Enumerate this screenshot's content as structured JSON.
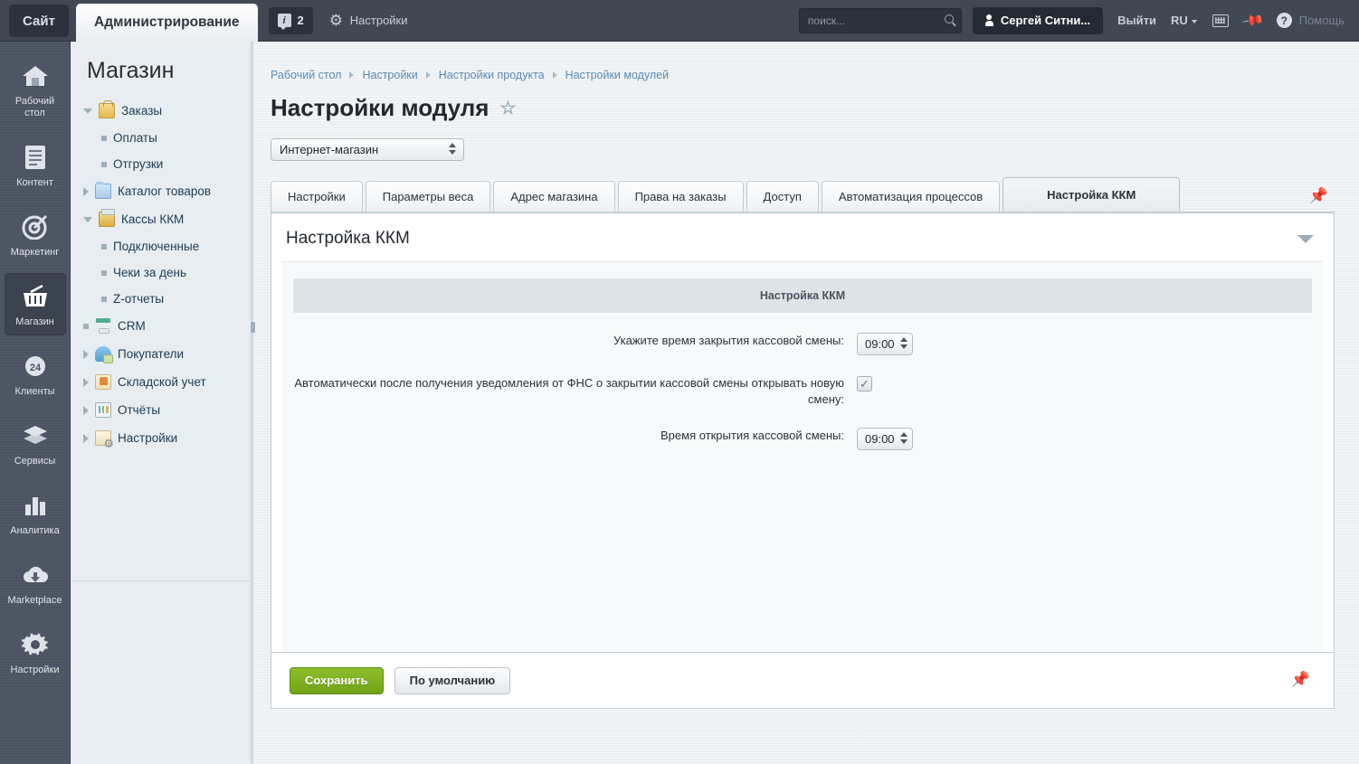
{
  "topbar": {
    "site_tab": "Сайт",
    "admin_tab": "Администрирование",
    "notif_count": "2",
    "notif_icon": "info-icon",
    "settings_label": "Настройки",
    "settings_icon": "gear-icon",
    "search_placeholder": "поиск...",
    "search_value": "",
    "search_icon": "search-icon",
    "user_name": "Сергей Ситни...",
    "user_icon": "person-icon",
    "logout_label": "Выйти",
    "lang_label": "RU",
    "keyboard_icon": "keyboard-icon",
    "pin_icon": "pin-icon",
    "help_label": "Помощь",
    "help_icon": "question-icon"
  },
  "rail": {
    "items": [
      {
        "label": "Рабочий стол",
        "icon": "home-icon",
        "active": false
      },
      {
        "label": "Контент",
        "icon": "document-icon",
        "active": false
      },
      {
        "label": "Маркетинг",
        "icon": "target-icon",
        "active": false
      },
      {
        "label": "Магазин",
        "icon": "basket-icon",
        "active": true
      },
      {
        "label": "Клиенты",
        "icon": "cloud24-icon",
        "active": false
      },
      {
        "label": "Сервисы",
        "icon": "layers-icon",
        "active": false
      },
      {
        "label": "Аналитика",
        "icon": "barchart-icon",
        "active": false
      },
      {
        "label": "Marketplace",
        "icon": "cloud-download-icon",
        "active": false
      },
      {
        "label": "Настройки",
        "icon": "gear-icon",
        "active": false
      }
    ]
  },
  "sidebar": {
    "title": "Магазин",
    "items": [
      {
        "label": "Заказы",
        "level": 0,
        "state": "open",
        "icon": "bag-icon"
      },
      {
        "label": "Оплаты",
        "level": 1,
        "state": "leaf",
        "icon": "bullet-icon"
      },
      {
        "label": "Отгрузки",
        "level": 1,
        "state": "leaf",
        "icon": "bullet-icon"
      },
      {
        "label": "Каталог товаров",
        "level": 0,
        "state": "closed",
        "icon": "folder-icon"
      },
      {
        "label": "Кассы ККМ",
        "level": 0,
        "state": "open",
        "icon": "cashregister-icon"
      },
      {
        "label": "Подключенные",
        "level": 1,
        "state": "leaf",
        "icon": "bullet-icon"
      },
      {
        "label": "Чеки за день",
        "level": 1,
        "state": "leaf",
        "icon": "bullet-icon"
      },
      {
        "label": "Z-отчеты",
        "level": 1,
        "state": "leaf",
        "icon": "bullet-icon"
      },
      {
        "label": "CRM",
        "level": 0,
        "state": "dot",
        "icon": "crm-icon"
      },
      {
        "label": "Покупатели",
        "level": 0,
        "state": "closed",
        "icon": "users-icon"
      },
      {
        "label": "Складской учет",
        "level": 0,
        "state": "closed",
        "icon": "warehouse-icon"
      },
      {
        "label": "Отчёты",
        "level": 0,
        "state": "closed",
        "icon": "report-icon"
      },
      {
        "label": "Настройки",
        "level": 0,
        "state": "closed",
        "icon": "settings-icon"
      }
    ]
  },
  "breadcrumbs": [
    "Рабочий стол",
    "Настройки",
    "Настройки продукта",
    "Настройки модулей"
  ],
  "page": {
    "title": "Настройки модуля",
    "favorite_icon": "star-icon",
    "module_select_value": "Интернет-магазин"
  },
  "tabs": [
    {
      "label": "Настройки",
      "active": false
    },
    {
      "label": "Параметры веса",
      "active": false
    },
    {
      "label": "Адрес магазина",
      "active": false
    },
    {
      "label": "Права на заказы",
      "active": false
    },
    {
      "label": "Доступ",
      "active": false
    },
    {
      "label": "Автоматизация процессов",
      "active": false
    },
    {
      "label": "Настройка ККМ",
      "active": true
    }
  ],
  "panel": {
    "title": "Настройка ККМ",
    "collapse_icon": "chevron-down-icon",
    "section_header": "Настройка ККМ",
    "fields": [
      {
        "label": "Укажите время закрытия кассовой смены:",
        "type": "time-select",
        "value": "09:00"
      },
      {
        "label": "Автоматически после получения уведомления от ФНС о закрытии кассовой смены открывать новую смену:",
        "type": "checkbox",
        "checked": true,
        "value": "✓"
      },
      {
        "label": "Время открытия кассовой смены:",
        "type": "time-select",
        "value": "09:00"
      }
    ]
  },
  "footer": {
    "save_label": "Сохранить",
    "default_label": "По умолчанию",
    "pin_icon": "pin-icon"
  },
  "colors": {
    "topbar": "#3e4651",
    "rail": "#4c5563",
    "sidebar": "#e7edf0",
    "accent_link": "#5b8bb5",
    "save_green": "#7aa81d",
    "canvas": "#eef2f4"
  }
}
